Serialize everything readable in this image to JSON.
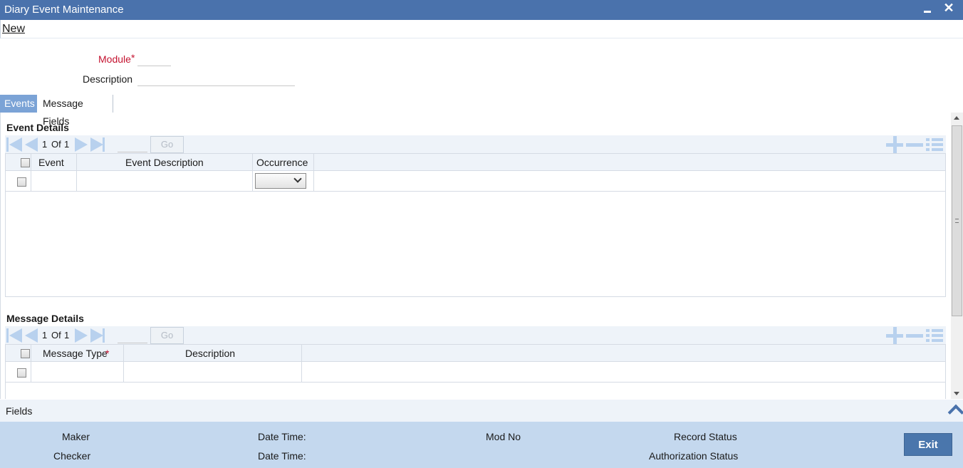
{
  "window": {
    "title": "Diary Event Maintenance"
  },
  "menu": {
    "new_label": "New"
  },
  "form": {
    "module_label": "Module",
    "module_required": "*",
    "module_value": "",
    "description_label": "Description",
    "description_value": ""
  },
  "tabs": [
    {
      "label": "Events",
      "active": true
    },
    {
      "label": "Message Fields",
      "active": false
    }
  ],
  "event_details": {
    "title": "Event Details",
    "pager": {
      "current": "1",
      "of_label": "Of",
      "total": "1",
      "go_label": "Go"
    },
    "columns": [
      "Event",
      "Event Description",
      "Occurrence"
    ],
    "rows": [
      {
        "event": "",
        "event_description": "",
        "occurrence": ""
      }
    ]
  },
  "message_details": {
    "title": "Message Details",
    "pager": {
      "current": "1",
      "of_label": "Of",
      "total": "1",
      "go_label": "Go"
    },
    "columns": [
      "Message Type",
      "Description"
    ],
    "message_type_required": "*",
    "rows": [
      {
        "message_type": "",
        "description": ""
      }
    ]
  },
  "fields_bar": {
    "label": "Fields"
  },
  "footer": {
    "maker_label": "Maker",
    "checker_label": "Checker",
    "date_time_label_1": "Date Time:",
    "date_time_label_2": "Date Time:",
    "mod_no_label": "Mod No",
    "record_status_label": "Record Status",
    "authorization_status_label": "Authorization Status",
    "exit_label": "Exit"
  },
  "colors": {
    "titlebar": "#4a72ac",
    "active_tab": "#7ba3d6",
    "required": "#c4122f",
    "footer": "#c4d8ee",
    "exit_button": "#4a76ac"
  }
}
